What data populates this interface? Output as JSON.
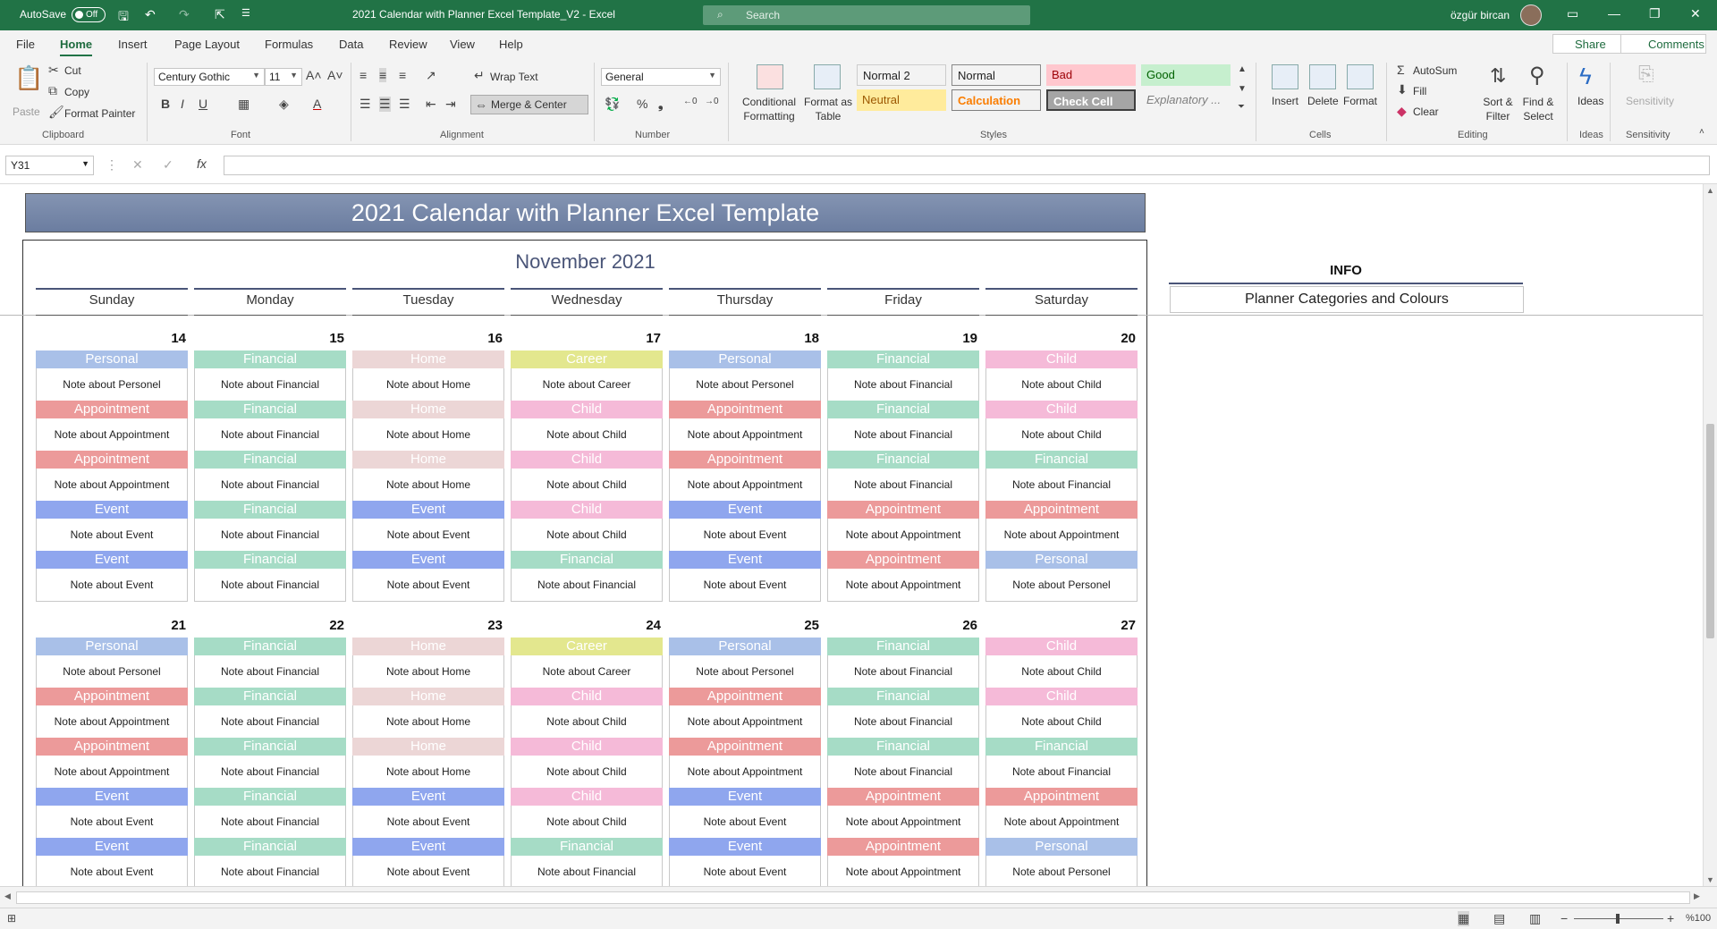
{
  "titlebar": {
    "autosave_label": "AutoSave",
    "autosave_state": "Off",
    "doc_title": "2021 Calendar with Planner Excel Template_V2  -  Excel",
    "search_placeholder": "Search",
    "username": "özgür bircan"
  },
  "menu": {
    "tabs": [
      "File",
      "Home",
      "Insert",
      "Page Layout",
      "Formulas",
      "Data",
      "Review",
      "View",
      "Help"
    ],
    "active": "Home",
    "share": "Share",
    "comments": "Comments"
  },
  "ribbon": {
    "clipboard": {
      "paste": "Paste",
      "cut": "Cut",
      "copy": "Copy",
      "format_painter": "Format Painter",
      "label": "Clipboard"
    },
    "font": {
      "name": "Century Gothic",
      "size": "11",
      "label": "Font"
    },
    "alignment": {
      "wrap_text": "Wrap Text",
      "merge_center": "Merge & Center",
      "label": "Alignment"
    },
    "number": {
      "format": "General",
      "label": "Number"
    },
    "styles": {
      "conditional": "Conditional Formatting",
      "format_table": "Format as Table",
      "cells": [
        {
          "text": "Normal 2",
          "bg": "#ffffff",
          "fg": "#000000"
        },
        {
          "text": "Normal",
          "bg": "#ffffff",
          "fg": "#000000"
        },
        {
          "text": "Bad",
          "bg": "#ffc7ce",
          "fg": "#9c0006"
        },
        {
          "text": "Good",
          "bg": "#c6efce",
          "fg": "#006100"
        },
        {
          "text": "Neutral",
          "bg": "#ffeb9c",
          "fg": "#9c5700"
        },
        {
          "text": "Calculation",
          "bg": "#f2f2f2",
          "fg": "#fa7d00"
        },
        {
          "text": "Check Cell",
          "bg": "#a5a5a5",
          "fg": "#ffffff"
        },
        {
          "text": "Explanatory ...",
          "bg": "#ffffff",
          "fg": "#7f7f7f"
        }
      ],
      "label": "Styles"
    },
    "cells": {
      "insert": "Insert",
      "delete": "Delete",
      "format": "Format",
      "label": "Cells"
    },
    "editing": {
      "autosum": "AutoSum",
      "fill": "Fill",
      "clear": "Clear",
      "sort_filter": "Sort & Filter",
      "find_select": "Find & Select",
      "label": "Editing"
    },
    "ideas": {
      "ideas": "Ideas",
      "label": "Ideas"
    },
    "sensitivity": {
      "sensitivity": "Sensitivity",
      "label": "Sensitivity"
    }
  },
  "formula_bar": {
    "name_box": "Y31",
    "content": ""
  },
  "sheet": {
    "banner": "2021 Calendar with Planner Excel Template",
    "month": "November 2021",
    "weekdays": [
      "Sunday",
      "Monday",
      "Tuesday",
      "Wednesday",
      "Thursday",
      "Friday",
      "Saturday"
    ],
    "info_title": "INFO",
    "info_subtitle": "Planner Categories and Colours",
    "category_colors": {
      "Personal": "#a9c0e8",
      "Financial": "#a6dcc6",
      "Home": "#ecd6d6",
      "Career": "#e3e78e",
      "Appointment": "#ec9a9a",
      "Event": "#8fa6ee",
      "Child": "#f5bad8"
    },
    "weeks": [
      {
        "days": [
          {
            "num": "14",
            "entries": [
              [
                "Personal",
                "Note about Personel"
              ],
              [
                "Appointment",
                "Note about Appointment"
              ],
              [
                "Appointment",
                "Note about Appointment"
              ],
              [
                "Event",
                "Note about Event"
              ],
              [
                "Event",
                "Note about Event"
              ]
            ]
          },
          {
            "num": "15",
            "entries": [
              [
                "Financial",
                "Note about Financial"
              ],
              [
                "Financial",
                "Note about Financial"
              ],
              [
                "Financial",
                "Note about Financial"
              ],
              [
                "Financial",
                "Note about Financial"
              ],
              [
                "Financial",
                "Note about Financial"
              ]
            ]
          },
          {
            "num": "16",
            "entries": [
              [
                "Home",
                "Note about Home"
              ],
              [
                "Home",
                "Note about Home"
              ],
              [
                "Home",
                "Note about Home"
              ],
              [
                "Event",
                "Note about Event"
              ],
              [
                "Event",
                "Note about Event"
              ]
            ]
          },
          {
            "num": "17",
            "entries": [
              [
                "Career",
                "Note about Career"
              ],
              [
                "Child",
                "Note about Child"
              ],
              [
                "Child",
                "Note about Child"
              ],
              [
                "Child",
                "Note about Child"
              ],
              [
                "Financial",
                "Note about Financial"
              ]
            ]
          },
          {
            "num": "18",
            "entries": [
              [
                "Personal",
                "Note about Personel"
              ],
              [
                "Appointment",
                "Note about Appointment"
              ],
              [
                "Appointment",
                "Note about Appointment"
              ],
              [
                "Event",
                "Note about Event"
              ],
              [
                "Event",
                "Note about Event"
              ]
            ]
          },
          {
            "num": "19",
            "entries": [
              [
                "Financial",
                "Note about Financial"
              ],
              [
                "Financial",
                "Note about Financial"
              ],
              [
                "Financial",
                "Note about Financial"
              ],
              [
                "Appointment",
                "Note about Appointment"
              ],
              [
                "Appointment",
                "Note about Appointment"
              ]
            ]
          },
          {
            "num": "20",
            "entries": [
              [
                "Child",
                "Note about Child"
              ],
              [
                "Child",
                "Note about Child"
              ],
              [
                "Financial",
                "Note about Financial"
              ],
              [
                "Appointment",
                "Note about Appointment"
              ],
              [
                "Personal",
                "Note about Personel"
              ]
            ]
          }
        ]
      },
      {
        "days": [
          {
            "num": "21",
            "entries": [
              [
                "Personal",
                "Note about Personel"
              ],
              [
                "Appointment",
                "Note about Appointment"
              ],
              [
                "Appointment",
                "Note about Appointment"
              ],
              [
                "Event",
                "Note about Event"
              ],
              [
                "Event",
                "Note about Event"
              ]
            ]
          },
          {
            "num": "22",
            "entries": [
              [
                "Financial",
                "Note about Financial"
              ],
              [
                "Financial",
                "Note about Financial"
              ],
              [
                "Financial",
                "Note about Financial"
              ],
              [
                "Financial",
                "Note about Financial"
              ],
              [
                "Financial",
                "Note about Financial"
              ]
            ]
          },
          {
            "num": "23",
            "entries": [
              [
                "Home",
                "Note about Home"
              ],
              [
                "Home",
                "Note about Home"
              ],
              [
                "Home",
                "Note about Home"
              ],
              [
                "Event",
                "Note about Event"
              ],
              [
                "Event",
                "Note about Event"
              ]
            ]
          },
          {
            "num": "24",
            "entries": [
              [
                "Career",
                "Note about Career"
              ],
              [
                "Child",
                "Note about Child"
              ],
              [
                "Child",
                "Note about Child"
              ],
              [
                "Child",
                "Note about Child"
              ],
              [
                "Financial",
                "Note about Financial"
              ]
            ]
          },
          {
            "num": "25",
            "entries": [
              [
                "Personal",
                "Note about Personel"
              ],
              [
                "Appointment",
                "Note about Appointment"
              ],
              [
                "Appointment",
                "Note about Appointment"
              ],
              [
                "Event",
                "Note about Event"
              ],
              [
                "Event",
                "Note about Event"
              ]
            ]
          },
          {
            "num": "26",
            "entries": [
              [
                "Financial",
                "Note about Financial"
              ],
              [
                "Financial",
                "Note about Financial"
              ],
              [
                "Financial",
                "Note about Financial"
              ],
              [
                "Appointment",
                "Note about Appointment"
              ],
              [
                "Appointment",
                "Note about Appointment"
              ]
            ]
          },
          {
            "num": "27",
            "entries": [
              [
                "Child",
                "Note about Child"
              ],
              [
                "Child",
                "Note about Child"
              ],
              [
                "Financial",
                "Note about Financial"
              ],
              [
                "Appointment",
                "Note about Appointment"
              ],
              [
                "Personal",
                "Note about Personel"
              ]
            ]
          }
        ]
      }
    ]
  },
  "status": {
    "zoom": "%100"
  }
}
